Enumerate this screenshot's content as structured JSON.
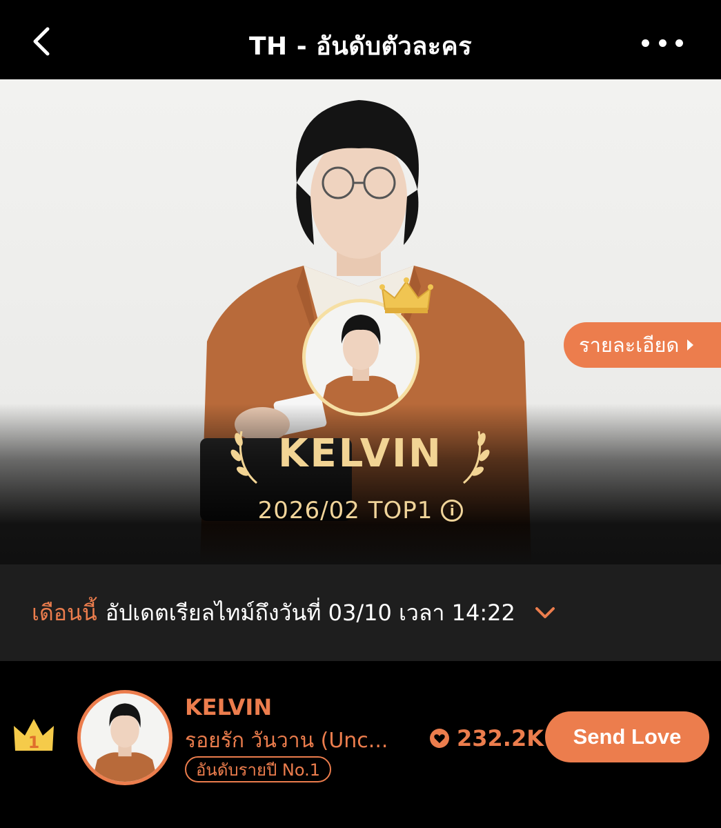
{
  "header": {
    "title": "TH - อันดับตัวละคร",
    "back_icon": "chevron-left-icon",
    "more_icon": "more-dots-icon"
  },
  "hero": {
    "detail_label": "รายละเอียด",
    "star_name": "KELVIN",
    "top_label": "2026/02 TOP1",
    "info_icon_glyph": "i"
  },
  "update": {
    "month_label": "เดือนนี้",
    "description": "อัปเดตเรียลไทม์ถึงวันที่ 03/10 เวลา 14:22"
  },
  "ranking": {
    "rank_number": "1",
    "name": "KELVIN",
    "show_title": "รอยรัก วันวาน (Unc...",
    "badge": "อันดับรายปี No.1",
    "love_count": "232.2K",
    "send_label": "Send Love"
  },
  "colors": {
    "accent": "#ec7d4d",
    "gold": "#f2d494",
    "header_bg": "#000000",
    "bar_bg": "#1e1e1e"
  }
}
